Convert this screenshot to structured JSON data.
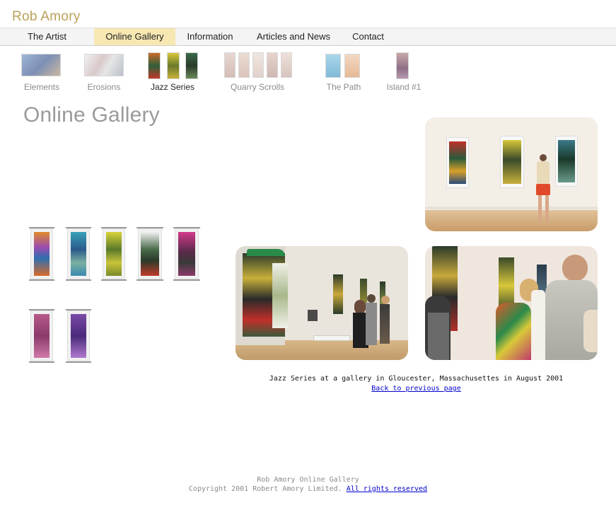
{
  "site": {
    "brand": "Rob Amory"
  },
  "nav": {
    "items": [
      {
        "label": "The Artist"
      },
      {
        "label": "Online Gallery"
      },
      {
        "label": "Information"
      },
      {
        "label": "Articles and News"
      },
      {
        "label": "Contact"
      }
    ],
    "active_color": "#f7e7b2"
  },
  "series": [
    {
      "label": "Elements"
    },
    {
      "label": "Erosions"
    },
    {
      "label": "Jazz Series"
    },
    {
      "label": "Quarry Scrolls"
    },
    {
      "label": "The Path"
    },
    {
      "label": "Island #1"
    }
  ],
  "page": {
    "title": "Online Gallery"
  },
  "gallery": {
    "caption": "Jazz Series at a gallery in Gloucester, Massachusettes in August 2001",
    "back_link": "Back to previous page"
  },
  "footer": {
    "line1": "Rob Amory Online Gallery",
    "copyright": "Copyright 2001 Robert Amory Limited.",
    "rights_link": "All rights reserved"
  },
  "colors": {
    "brand": "#b9a25a",
    "link": "#0000cc",
    "title": "#9a9a9a"
  }
}
